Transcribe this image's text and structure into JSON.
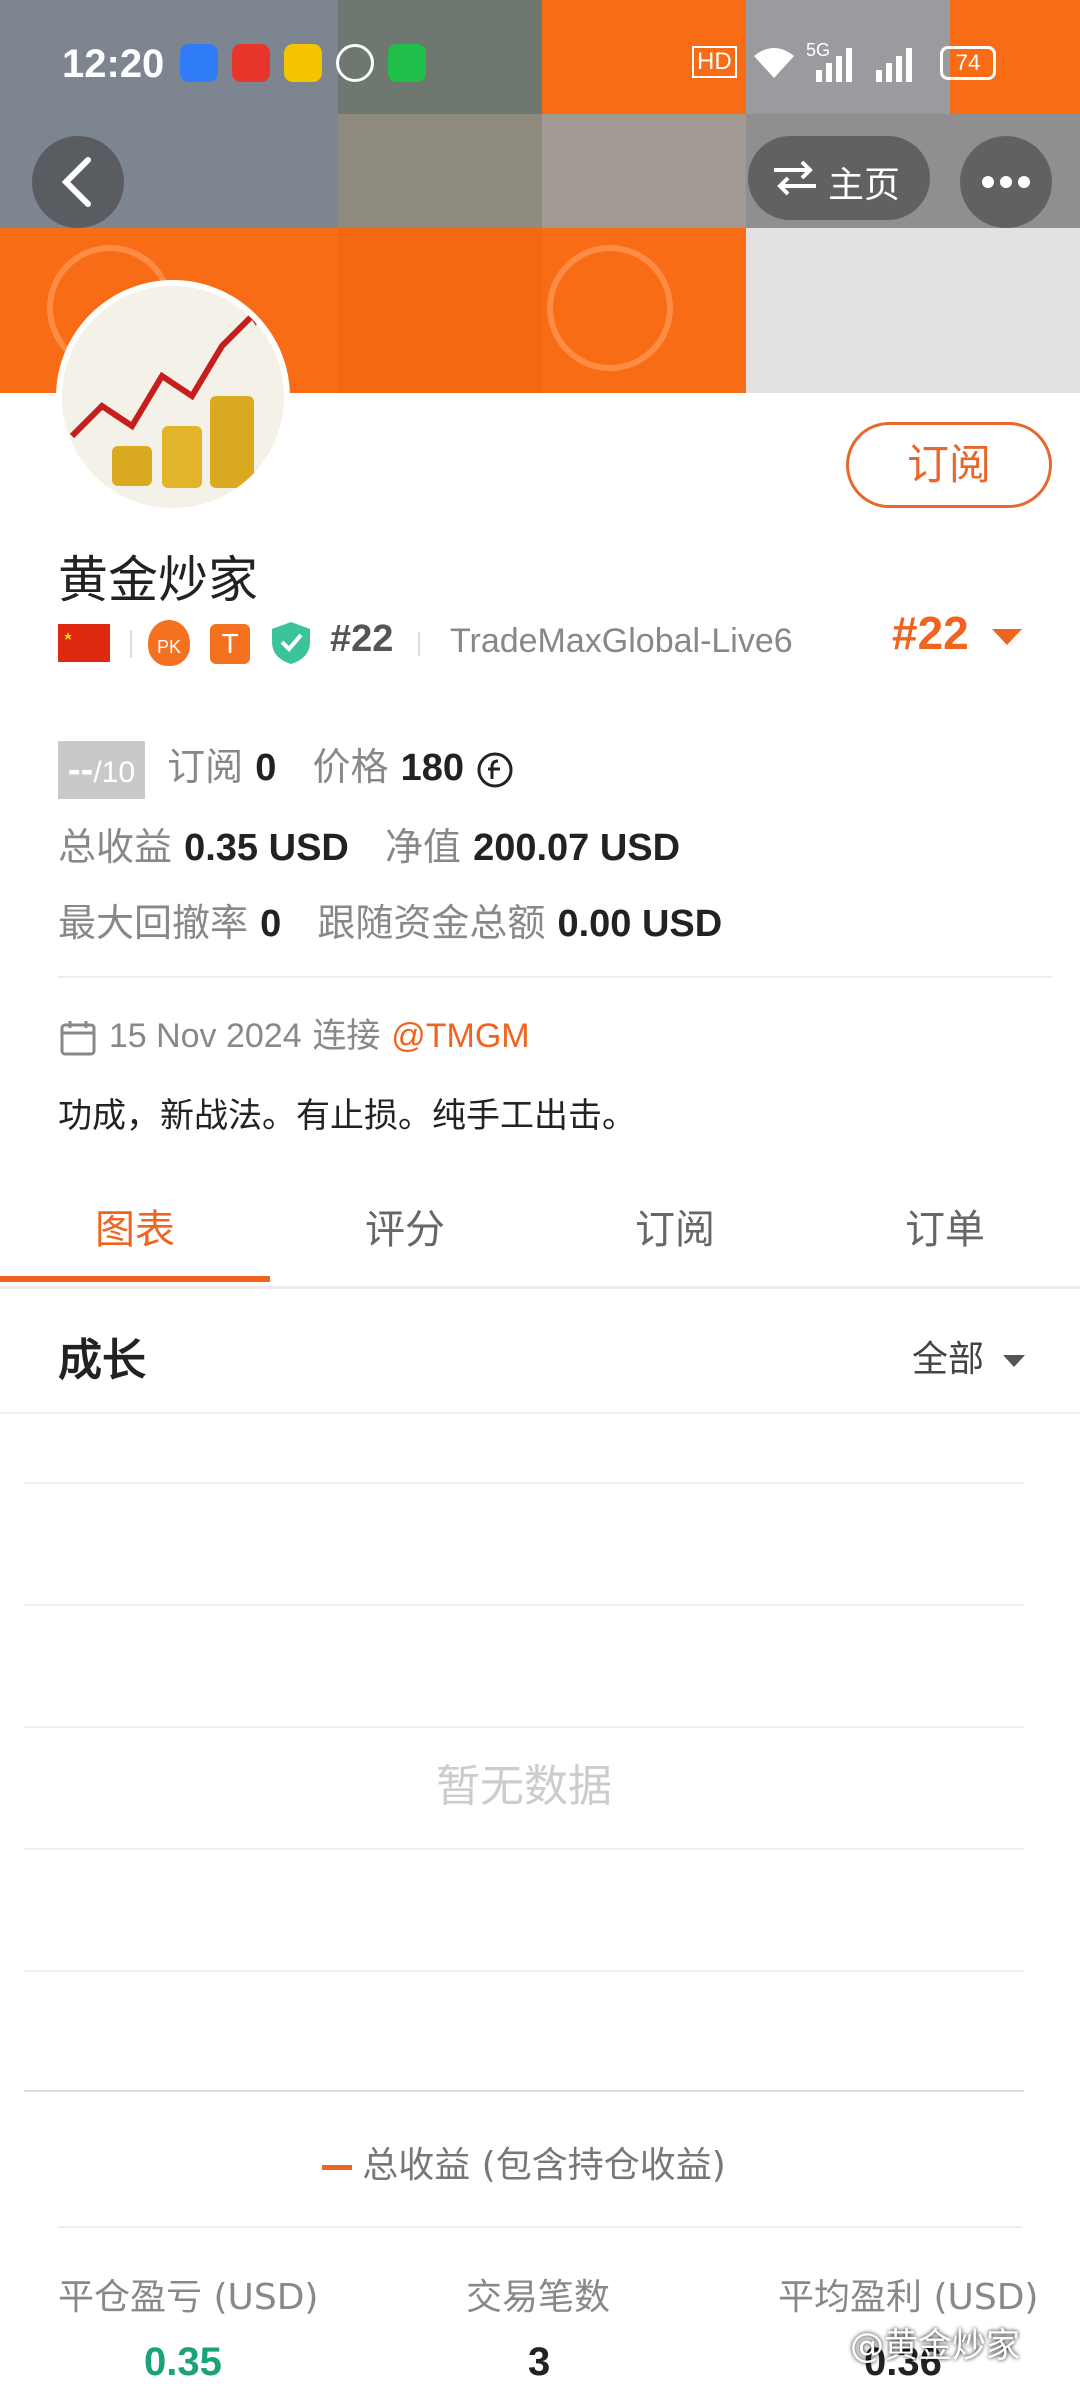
{
  "status_bar": {
    "time": "12:20",
    "battery": "74",
    "network": "5G"
  },
  "header": {
    "home_label": "主页"
  },
  "profile": {
    "name": "黄金炒家",
    "rank_badge": "#22",
    "broker": "TradeMaxGlobal-Live6",
    "rank_right": "#22",
    "subscribe_button": "订阅",
    "badge_pk": "PK",
    "badge_t": "T"
  },
  "stats": {
    "score": "--",
    "score_max": "/10",
    "subs_label": "订阅",
    "subs_value": "0",
    "price_label": "价格",
    "price_value": "180",
    "total_profit_label": "总收益",
    "total_profit_value": "0.35 USD",
    "equity_label": "净值",
    "equity_value": "200.07 USD",
    "max_drawdown_label": "最大回撤率",
    "max_drawdown_value": "0",
    "follow_funds_label": "跟随资金总额",
    "follow_funds_value": "0.00 USD"
  },
  "connection": {
    "date": "15 Nov 2024",
    "connect_label": "连接",
    "broker_handle": "@TMGM"
  },
  "bio": "功成，新战法。有止损。纯手工出击。",
  "tabs": [
    {
      "label": "图表"
    },
    {
      "label": "评分"
    },
    {
      "label": "订阅"
    },
    {
      "label": "订单"
    }
  ],
  "growth": {
    "title": "成长",
    "filter": "全部",
    "empty_text": "暂无数据",
    "legend": "总收益 (包含持仓收益)"
  },
  "metrics": [
    {
      "label": "平仓盈亏 (USD)",
      "value": "0.35"
    },
    {
      "label": "交易笔数",
      "value": "3"
    },
    {
      "label": "平均盈利 (USD)",
      "value": "0.36"
    }
  ],
  "watermark": "@黄金炒家",
  "colors": {
    "accent": "#f0641f",
    "positive": "#1aa37a",
    "cover_orange": "#f96c16"
  }
}
